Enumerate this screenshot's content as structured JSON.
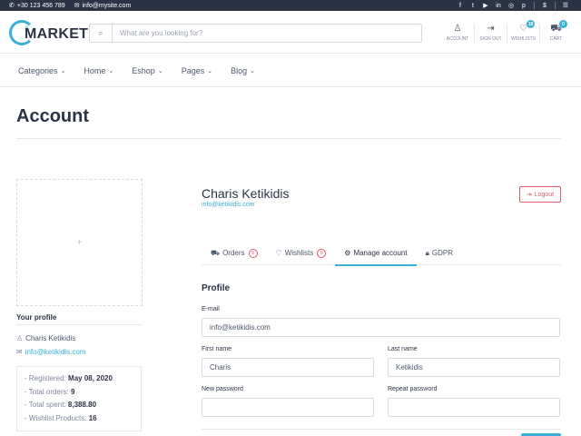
{
  "topbar": {
    "phone": "+30 123 456 789",
    "email": "info@mysite.com",
    "social_icons": [
      "facebook-icon",
      "twitter-icon",
      "youtube-icon",
      "linkedin-icon",
      "instagram-icon",
      "pinterest-icon"
    ],
    "currency": "$"
  },
  "header": {
    "logo_small": "e",
    "logo_text": "MARKET",
    "search_placeholder": "What are you looking for?",
    "actions": [
      {
        "label": "ACCOUNT",
        "icon": "user-icon"
      },
      {
        "label": "SIGN OUT",
        "icon": "sign-out-icon"
      },
      {
        "label": "WISHLISTS",
        "icon": "heart-icon",
        "badge": "18"
      },
      {
        "label": "CART",
        "icon": "cart-icon",
        "badge": "0"
      }
    ]
  },
  "nav": {
    "items": [
      "Categories",
      "Home",
      "Eshop",
      "Pages",
      "Blog"
    ]
  },
  "page": {
    "title": "Account"
  },
  "sidebar": {
    "avatar_placeholder": "+",
    "heading": "Your profile",
    "name": "Charis Ketikidis",
    "email": "info@ketikidis.com",
    "stats": [
      {
        "label": "- Registered: ",
        "value": "May 08, 2020"
      },
      {
        "label": "- Total orders: ",
        "value": "9"
      },
      {
        "label": "- Total spent: ",
        "value": "8,388.80"
      },
      {
        "label": "- Wishlist Products: ",
        "value": "16"
      }
    ]
  },
  "profile": {
    "name": "Charis Ketikidis",
    "email": "info@ketikidis.com",
    "logout_label": "Logout"
  },
  "tabs": [
    {
      "label": "Orders",
      "count": "9",
      "icon": "cart-icon",
      "active": false
    },
    {
      "label": "Wishlists",
      "count": "9",
      "icon": "heart-icon",
      "active": false
    },
    {
      "label": "Manage account",
      "icon": "gear-icon",
      "active": true
    },
    {
      "label": "GDPR",
      "icon": "lock-icon",
      "active": false
    }
  ],
  "form": {
    "section_title": "Profile",
    "email_label": "E-mail",
    "email_value": "info@ketikidis.com",
    "first_name_label": "First name",
    "first_name_value": "Charis",
    "last_name_label": "Last name",
    "last_name_value": "Ketikidis",
    "new_password_label": "New password",
    "repeat_password_label": "Repeat password"
  },
  "colors": {
    "accent": "#3ab0d7",
    "danger": "#e05b6b",
    "dark": "#2b3445"
  }
}
